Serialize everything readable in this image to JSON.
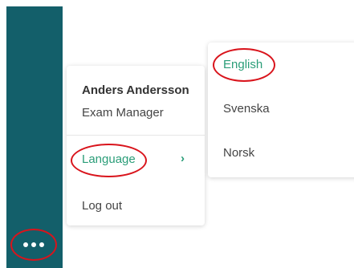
{
  "user": {
    "name": "Anders Andersson",
    "role": "Exam Manager"
  },
  "menu": {
    "language_label": "Language",
    "language_chevron": "›",
    "logout_label": "Log out"
  },
  "language_submenu": {
    "options": [
      "English",
      "Svenska",
      "Norsk"
    ],
    "selected": "English"
  },
  "sidebar": {
    "more_icon": "more-horizontal-icon"
  },
  "colors": {
    "sidebar": "#135f6a",
    "accent": "#2a9d78",
    "highlight_ring": "#d9141c"
  }
}
